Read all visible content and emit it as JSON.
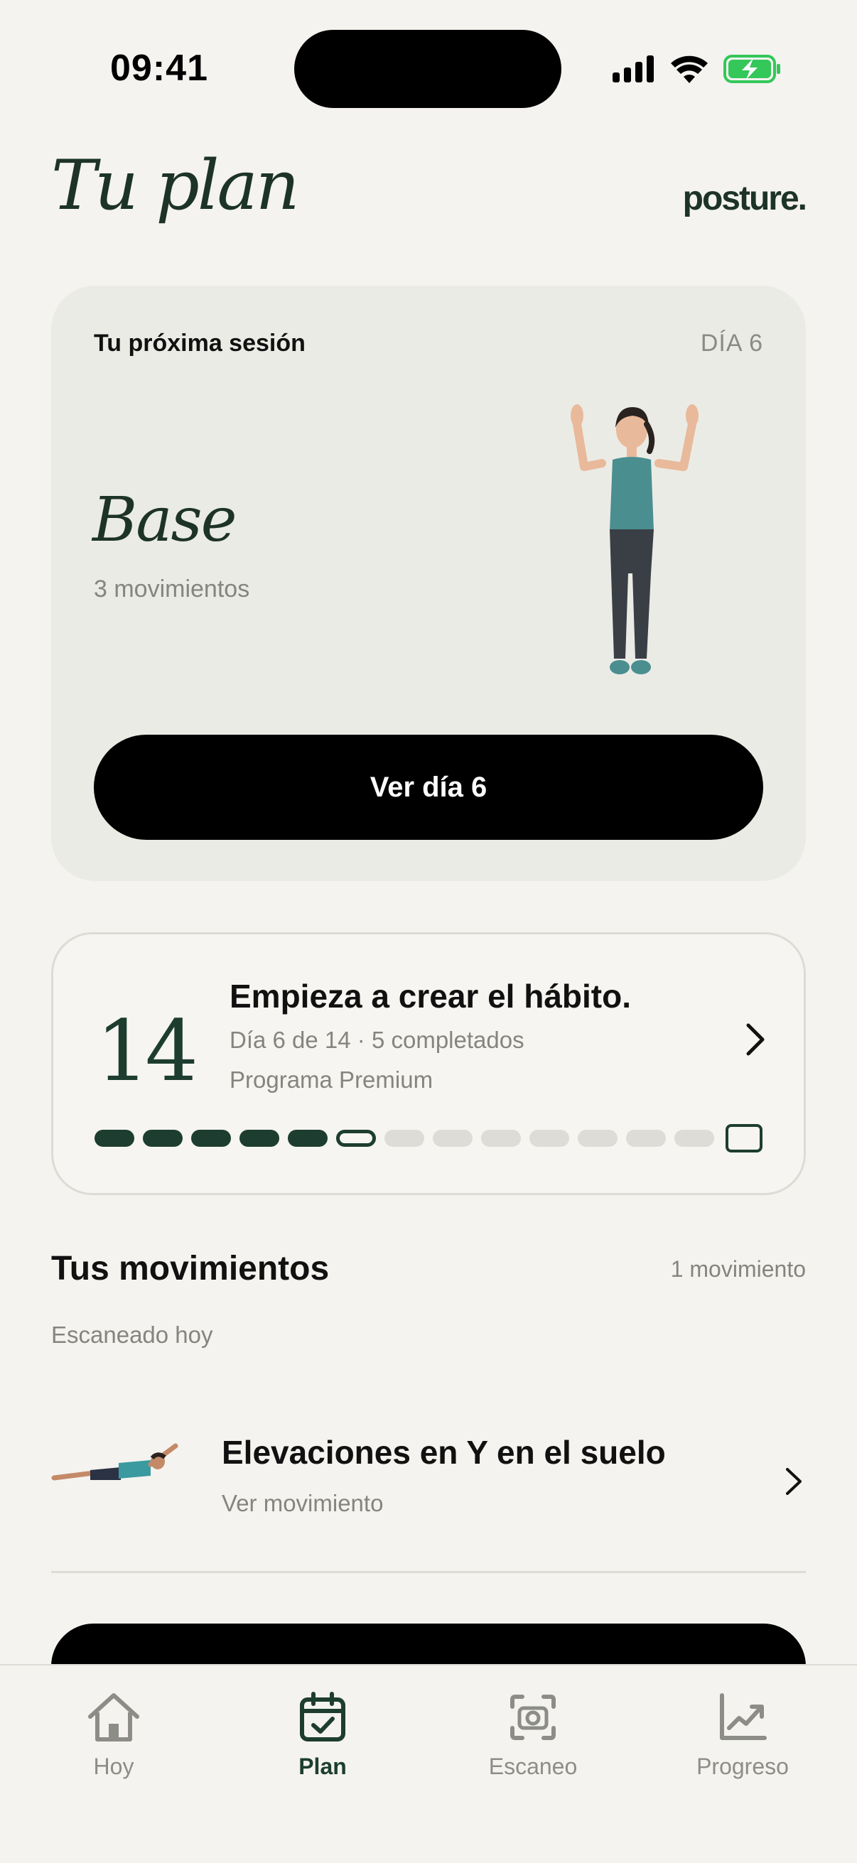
{
  "status_bar": {
    "time": "09:41"
  },
  "header": {
    "title": "Tu plan",
    "brand": "posture."
  },
  "session_card": {
    "label": "Tu próxima sesión",
    "day": "DÍA 6",
    "name": "Base",
    "count": "3 movimientos",
    "button_label": "Ver día 6"
  },
  "habit_card": {
    "number": "14",
    "title": "Empieza a crear el hábito.",
    "subtitle": "Día 6 de 14 · 5 completados",
    "program": "Programa Premium",
    "progress": {
      "total_days": 14,
      "completed": 5,
      "current_day": 6
    }
  },
  "movements": {
    "title": "Tus movimientos",
    "count": "1 movimiento",
    "subtitle": "Escaneado hoy",
    "items": [
      {
        "name": "Elevaciones en Y en el suelo",
        "link": "Ver movimiento"
      }
    ]
  },
  "tab_bar": {
    "tabs": [
      {
        "label": "Hoy",
        "icon": "home-icon",
        "active": false
      },
      {
        "label": "Plan",
        "icon": "calendar-check-icon",
        "active": true
      },
      {
        "label": "Escaneo",
        "icon": "camera-scan-icon",
        "active": false
      },
      {
        "label": "Progreso",
        "icon": "chart-icon",
        "active": false
      }
    ]
  },
  "colors": {
    "background": "#f4f3ef",
    "card": "#ebebe5",
    "accent": "#1d3d30",
    "muted_text": "#85857f",
    "battery": "#34c759"
  }
}
